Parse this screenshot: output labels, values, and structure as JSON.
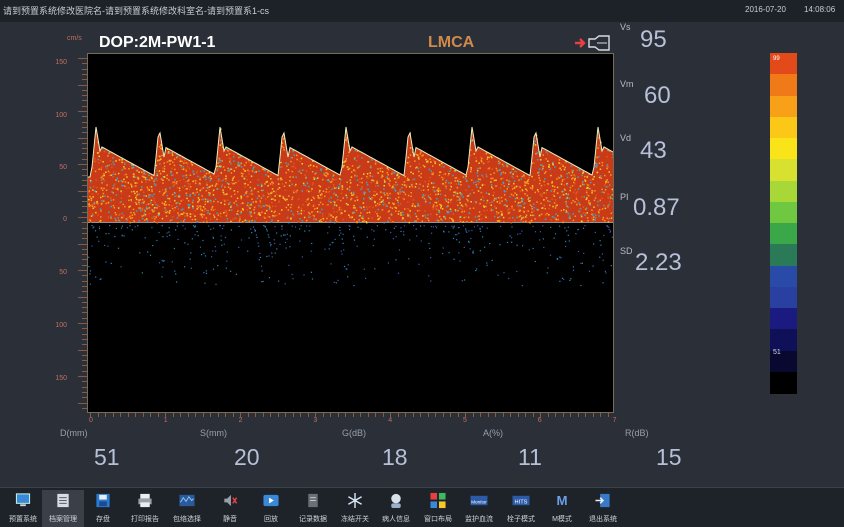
{
  "titlebar": {
    "title": "请到预置系统修改医院名-请到预置系统修改科室名-请到预置系1-cs",
    "date": "2016-07-20",
    "time": "14:08:06"
  },
  "graph": {
    "unit": "cm/s",
    "header_left": "DOP:2M-PW1-1",
    "header_center": "LMCA",
    "y_ticks_top": [
      "150",
      "100",
      "50",
      "0"
    ],
    "y_ticks_bottom": [
      "50",
      "100",
      "150"
    ],
    "x_ticks": [
      "0",
      "1",
      "2",
      "3",
      "4",
      "5",
      "6",
      "7"
    ]
  },
  "measurements": [
    {
      "label": "Vs",
      "value": "95"
    },
    {
      "label": "Vm",
      "value": "60"
    },
    {
      "label": "Vd",
      "value": "43"
    },
    {
      "label": "PI",
      "value": "0.87"
    },
    {
      "label": "SD",
      "value": "2.23"
    }
  ],
  "bottom_params": [
    {
      "label": "D(mm)",
      "value": "51"
    },
    {
      "label": "S(mm)",
      "value": "20"
    },
    {
      "label": "G(dB)",
      "value": "18"
    },
    {
      "label": "A(%)",
      "value": "11"
    },
    {
      "label": "R(dB)",
      "value": "15"
    }
  ],
  "colorbar": {
    "top_label": "99",
    "bottom_label": "51",
    "colors": [
      "#e34a1a",
      "#f07a18",
      "#f8a018",
      "#fcc818",
      "#f8e418",
      "#d8e030",
      "#a8d838",
      "#70c840",
      "#3aa848",
      "#2a7a58",
      "#2a4aa8",
      "#2a40a0",
      "#1a1a80",
      "#101058",
      "#080830",
      "#000000"
    ]
  },
  "toolbar": [
    {
      "label": "预置系统",
      "icon": "monitor-icon"
    },
    {
      "label": "档案管理",
      "icon": "archive-icon",
      "active": true
    },
    {
      "label": "存盘",
      "icon": "save-icon"
    },
    {
      "label": "打印报告",
      "icon": "printer-icon"
    },
    {
      "label": "包络选择",
      "icon": "envelope-icon"
    },
    {
      "label": "静音",
      "icon": "mute-icon"
    },
    {
      "label": "回放",
      "icon": "playback-icon"
    },
    {
      "label": "记录数据",
      "icon": "record-icon"
    },
    {
      "label": "冻结开关",
      "icon": "snowflake-icon"
    },
    {
      "label": "病人信息",
      "icon": "patient-icon"
    },
    {
      "label": "窗口布局",
      "icon": "layout-icon"
    },
    {
      "label": "监护血流",
      "icon": "monitor-flow-icon"
    },
    {
      "label": "栓子模式",
      "icon": "emboli-icon"
    },
    {
      "label": "M模式",
      "icon": "m-mode-icon"
    },
    {
      "label": "退出系统",
      "icon": "exit-icon"
    }
  ]
}
